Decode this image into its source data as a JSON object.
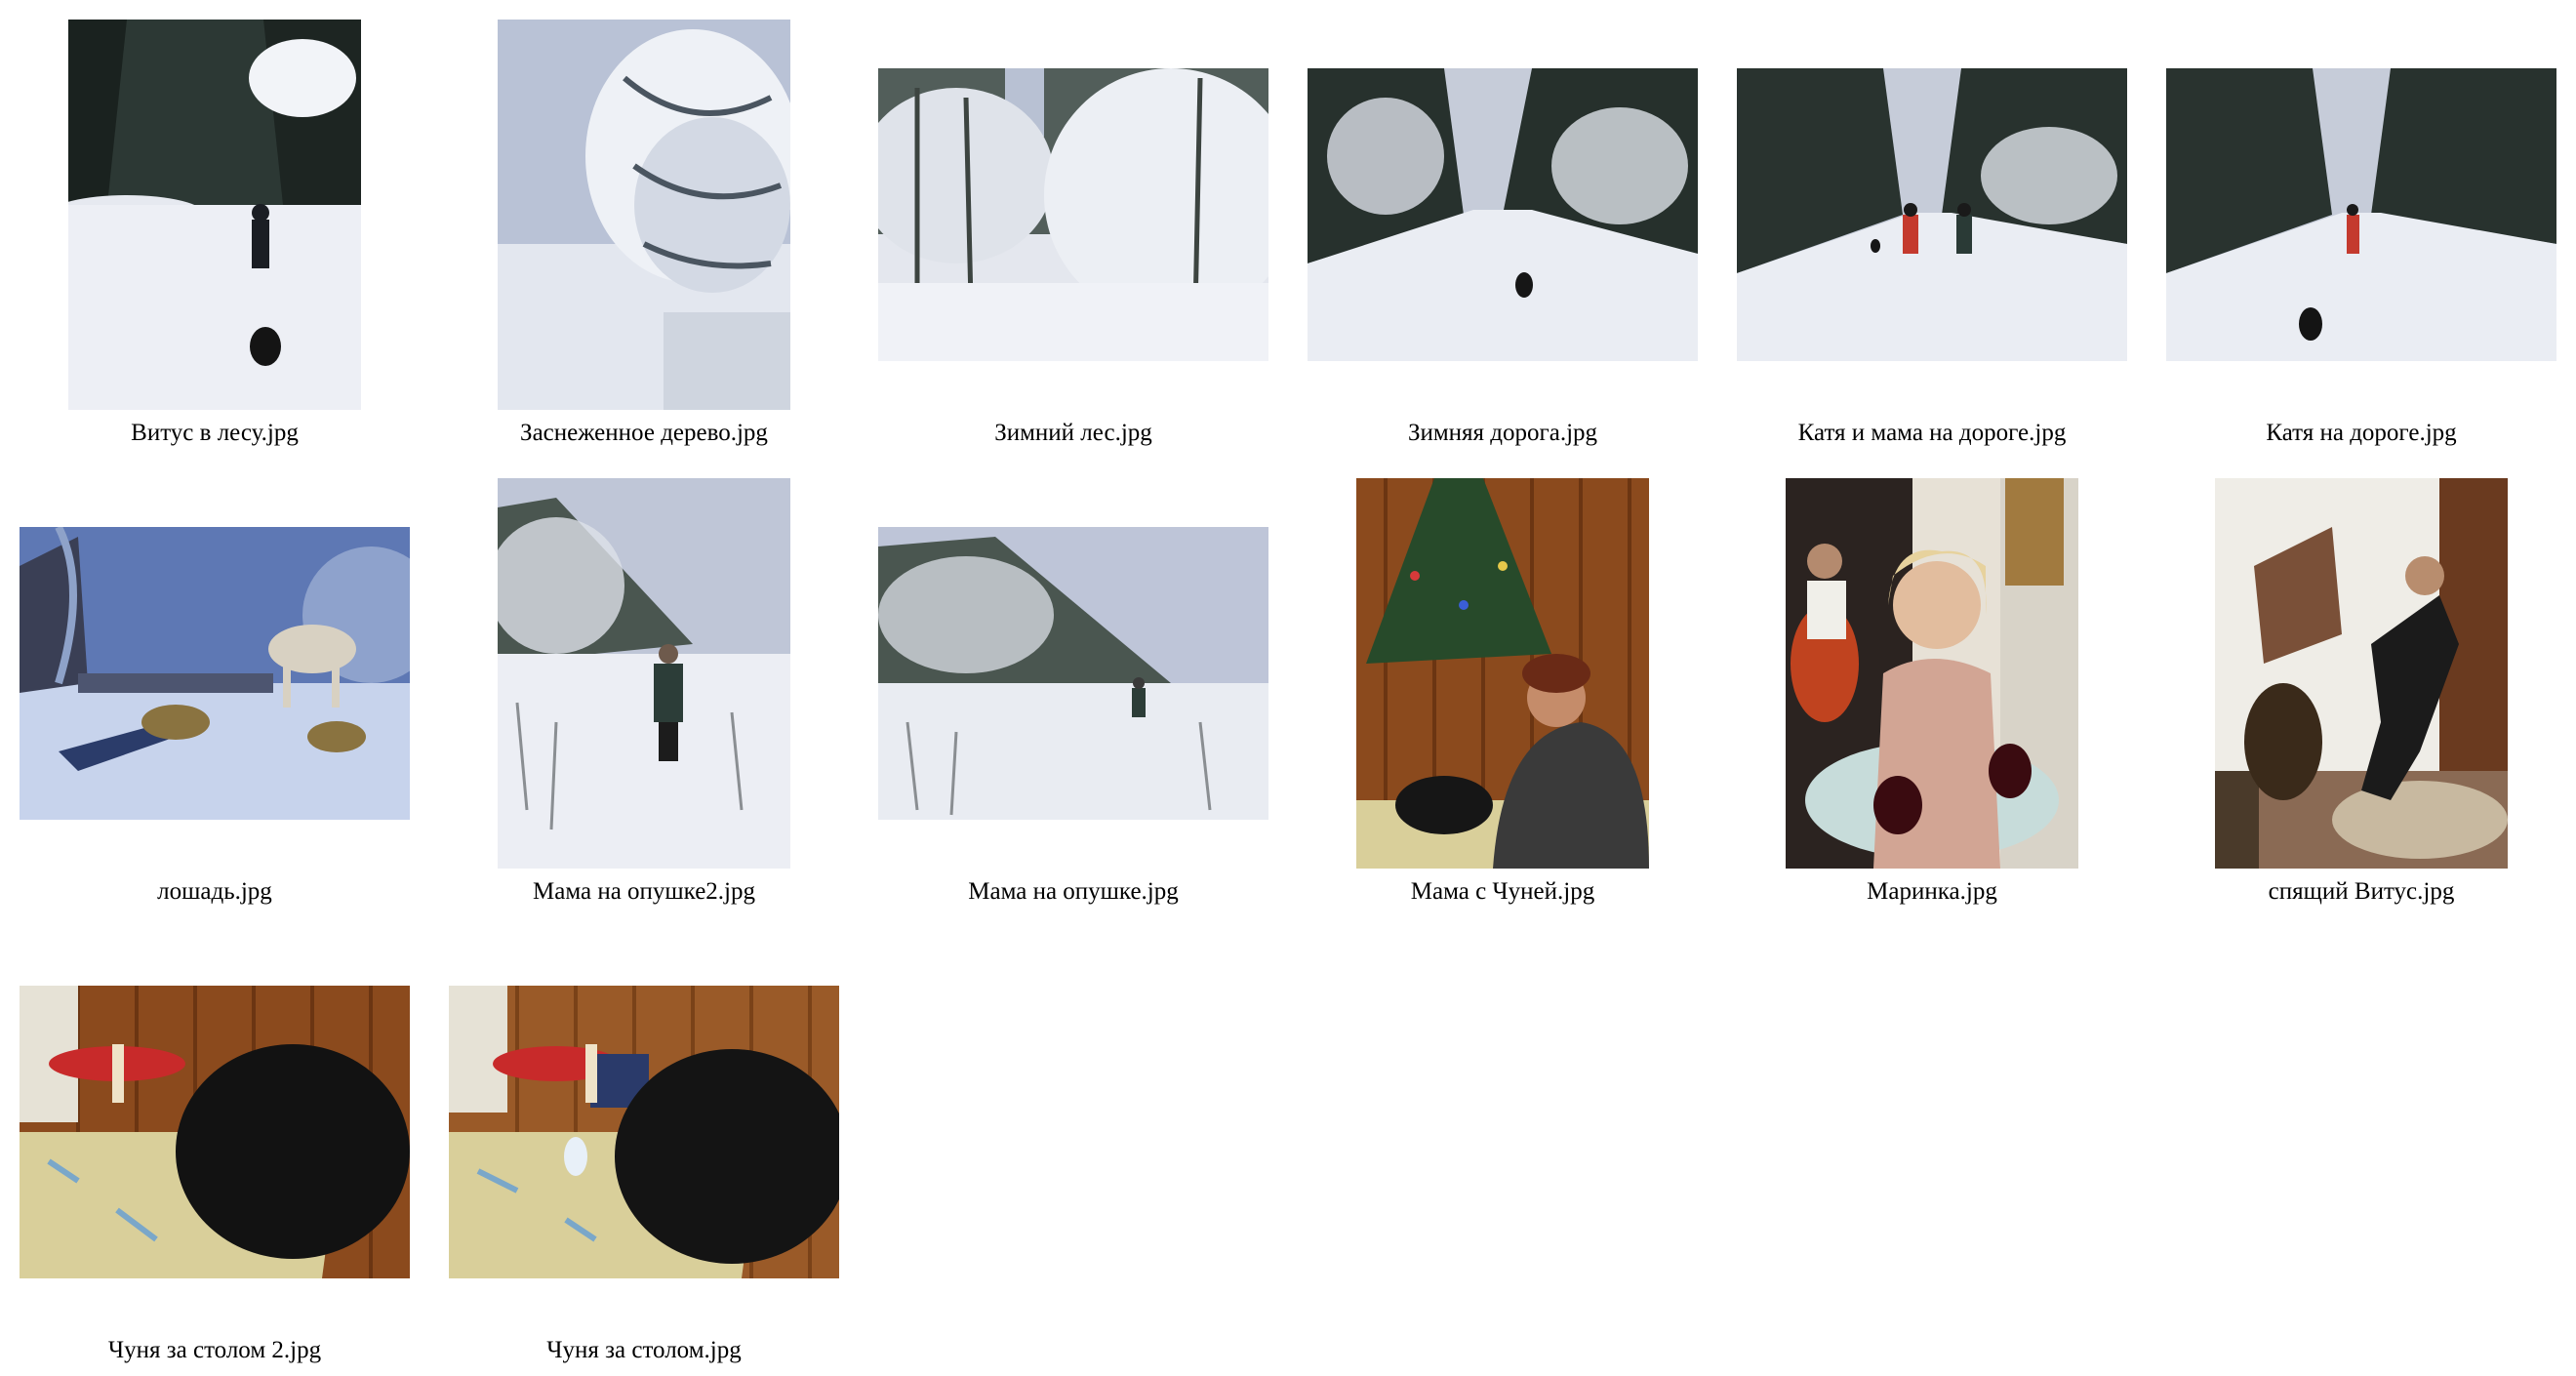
{
  "gallery": {
    "items": [
      {
        "filename": "Витус в лесу.jpg",
        "icon": "photo-thumbnail",
        "scene": "snowy-forest-person-dog"
      },
      {
        "filename": "Заснеженное дерево.jpg",
        "icon": "photo-thumbnail",
        "scene": "snow-tree"
      },
      {
        "filename": "Зимний лес.jpg",
        "icon": "photo-thumbnail",
        "scene": "winter-forest"
      },
      {
        "filename": "Зимняя дорога.jpg",
        "icon": "photo-thumbnail",
        "scene": "winter-road-dog"
      },
      {
        "filename": "Катя и мама на дороге.jpg",
        "icon": "photo-thumbnail",
        "scene": "winter-road-two-skiers"
      },
      {
        "filename": "Катя на дороге.jpg",
        "icon": "photo-thumbnail",
        "scene": "winter-road-skier-dog"
      },
      {
        "filename": "лошадь.jpg",
        "icon": "photo-thumbnail",
        "scene": "horse-sleigh"
      },
      {
        "filename": "Мама на опушке2.jpg",
        "icon": "photo-thumbnail",
        "scene": "skier-field-portrait"
      },
      {
        "filename": "Мама на опушке.jpg",
        "icon": "photo-thumbnail",
        "scene": "skier-field-far"
      },
      {
        "filename": "Мама с Чуней.jpg",
        "icon": "photo-thumbnail",
        "scene": "woman-christmas-tree"
      },
      {
        "filename": "Маринка.jpg",
        "icon": "photo-thumbnail",
        "scene": "girl-wine"
      },
      {
        "filename": "спящий Витус.jpg",
        "icon": "photo-thumbnail",
        "scene": "sleeping-man"
      },
      {
        "filename": "Чуня за столом 2.jpg",
        "icon": "photo-thumbnail",
        "scene": "dog-table-close"
      },
      {
        "filename": "Чуня за столом.jpg",
        "icon": "photo-thumbnail",
        "scene": "dog-table"
      }
    ]
  },
  "colors": {
    "snow": "#eef0f6",
    "sky": "#c8cedf",
    "forest": "#1f2a26",
    "wood": "#8a4a1c",
    "tablecloth": "#d9cf9a"
  }
}
